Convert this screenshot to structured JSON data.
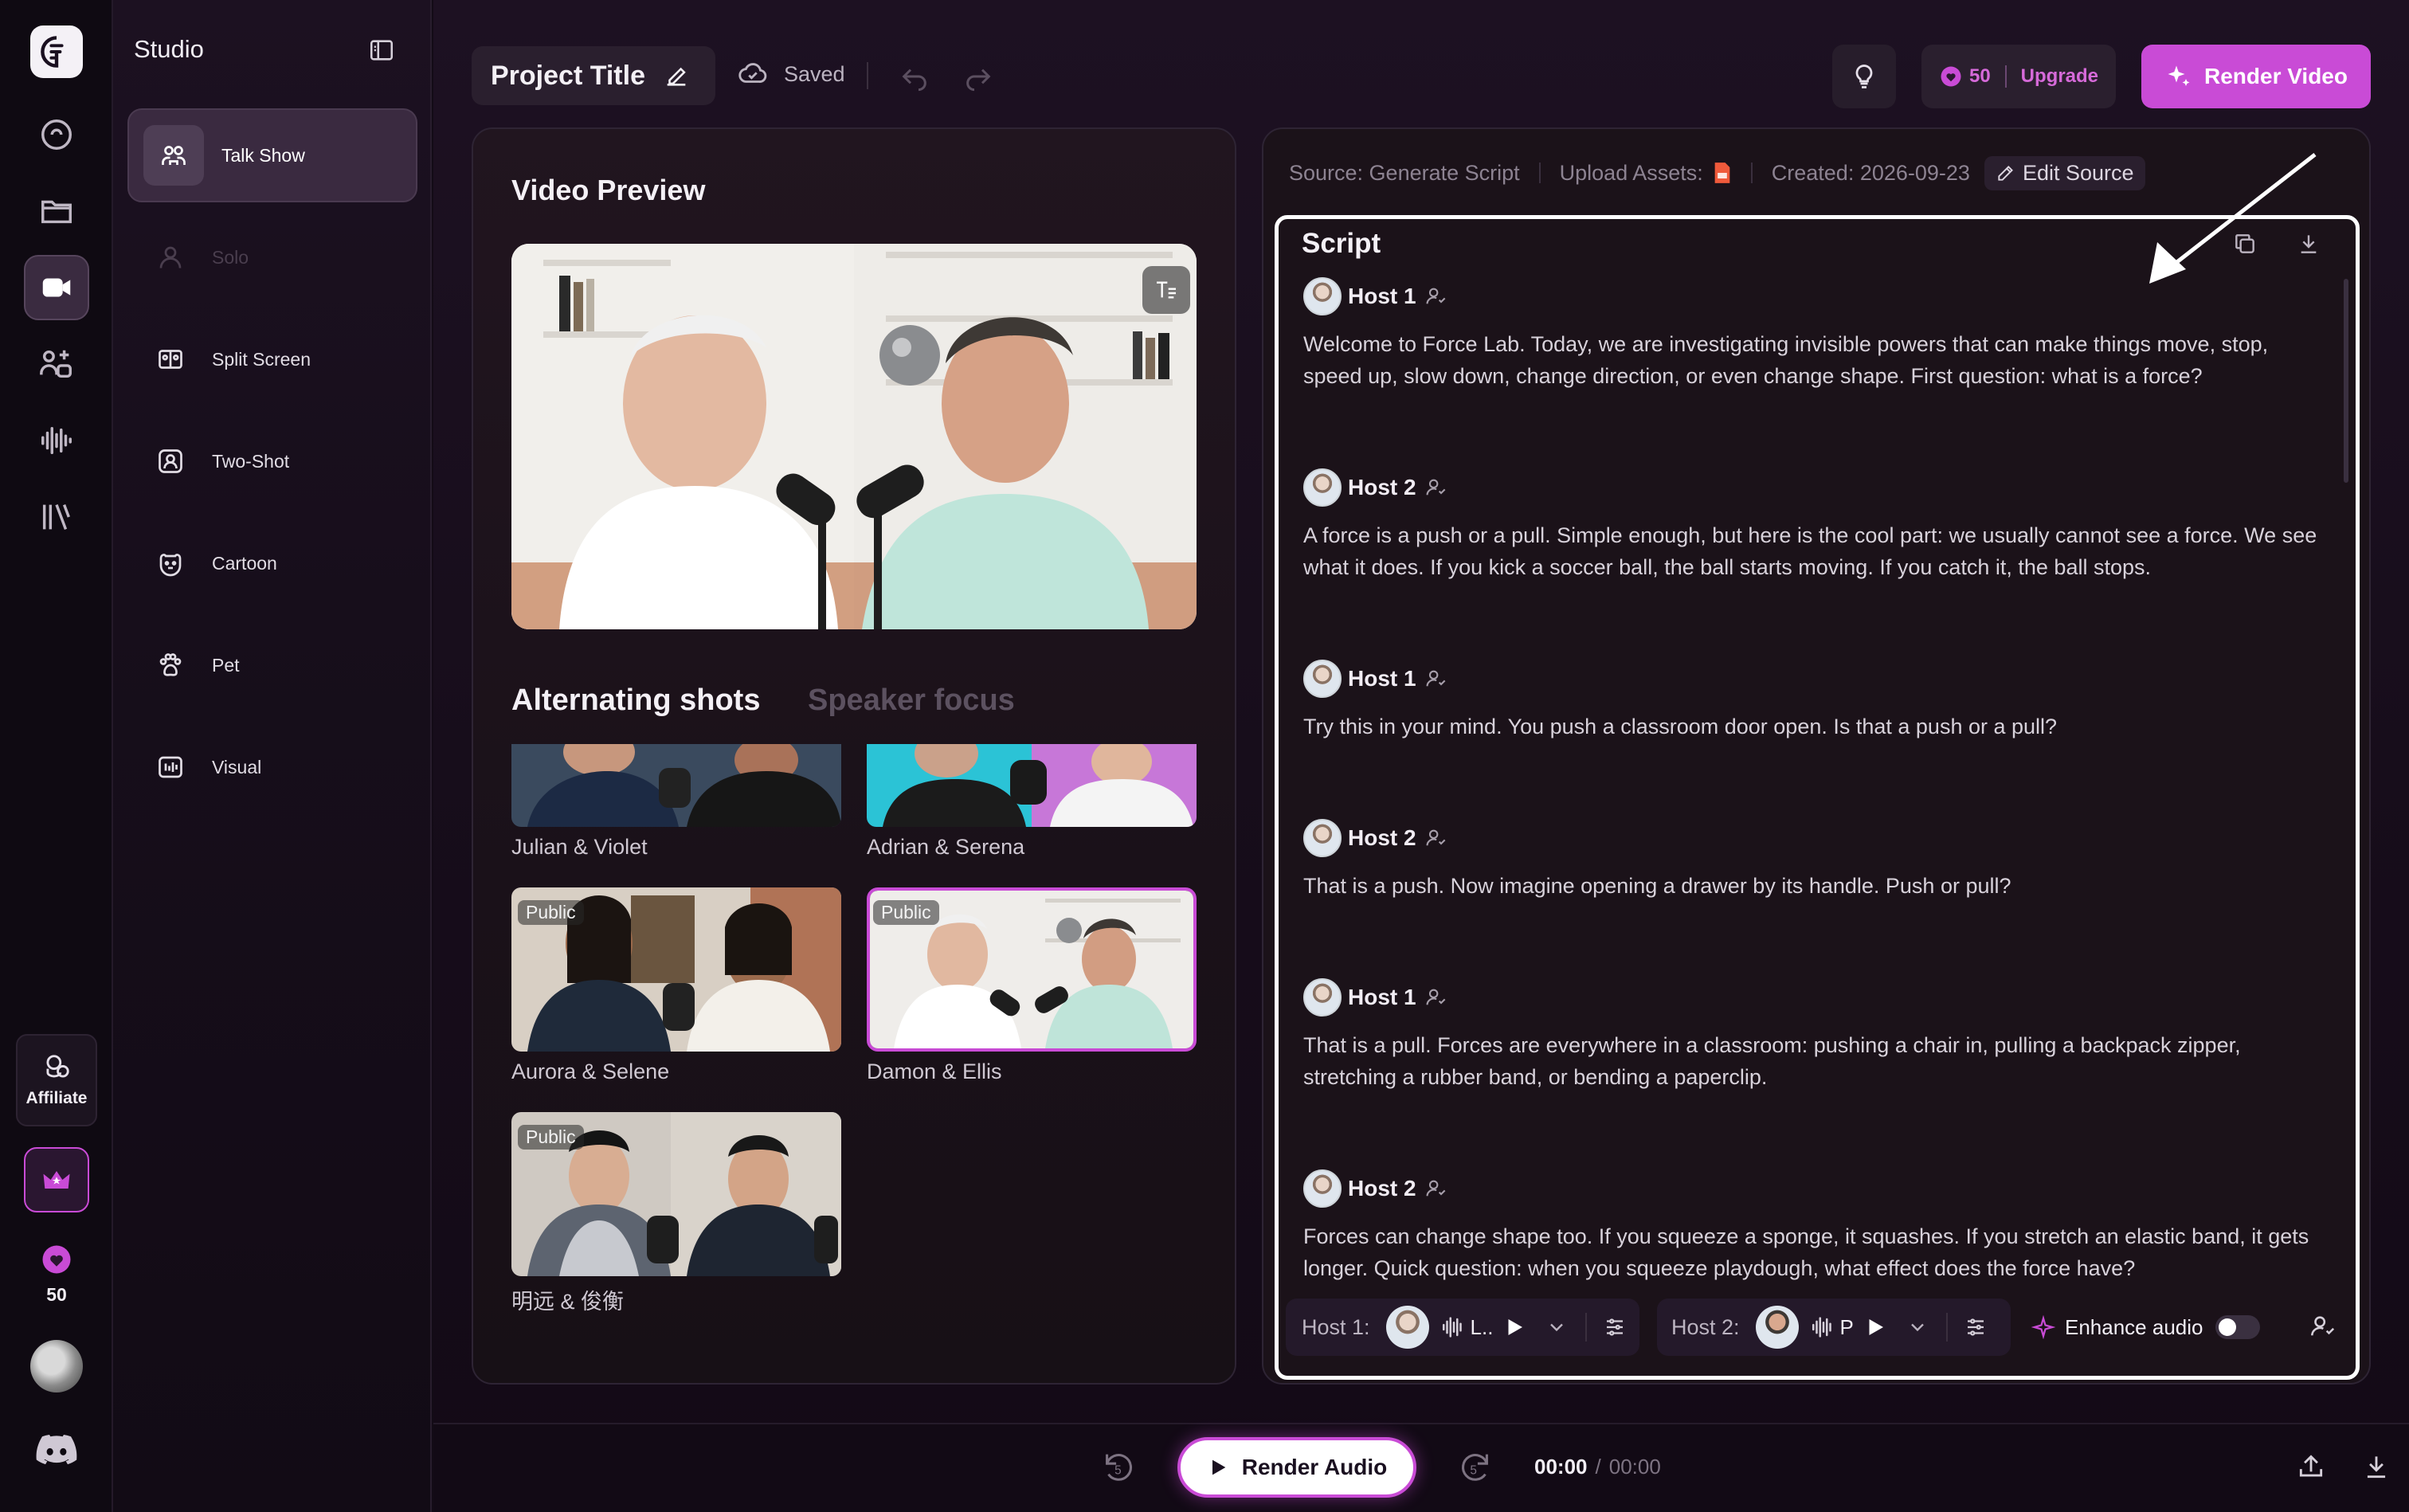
{
  "rail": {
    "affiliate_label": "Affiliate",
    "credits": "50"
  },
  "sidebar": {
    "title": "Studio",
    "items": [
      {
        "label": "Talk Show",
        "icon": "talk-show-icon"
      },
      {
        "label": "Solo",
        "icon": "solo-icon"
      },
      {
        "label": "Split Screen",
        "icon": "split-screen-icon"
      },
      {
        "label": "Two-Shot",
        "icon": "two-shot-icon"
      },
      {
        "label": "Cartoon",
        "icon": "cartoon-icon"
      },
      {
        "label": "Pet",
        "icon": "pet-icon"
      },
      {
        "label": "Visual",
        "icon": "visual-icon"
      }
    ]
  },
  "header": {
    "project_title": "Project Title",
    "saved": "Saved",
    "credits": "50",
    "upgrade": "Upgrade",
    "render_video": "Render Video"
  },
  "preview": {
    "title": "Video Preview",
    "tabs": [
      "Alternating shots",
      "Speaker focus"
    ],
    "pairs": [
      {
        "name": "Julian & Violet",
        "public": false
      },
      {
        "name": "Adrian & Serena",
        "public": false
      },
      {
        "name": "Aurora & Selene",
        "public": true
      },
      {
        "name": "Damon & Ellis",
        "public": true
      },
      {
        "name": "明远 & 俊衡",
        "public": true
      }
    ],
    "public_tag": "Public"
  },
  "source_bar": {
    "source": "Source: Generate Script",
    "upload": "Upload Assets:",
    "created": "Created: 2026-09-23",
    "edit_source": "Edit Source"
  },
  "script": {
    "title": "Script",
    "lines": [
      {
        "host": "Host 1",
        "text": "Welcome to Force Lab. Today, we are investigating invisible powers that can make things move, stop, speed up, slow down, change direction, or even change shape. First question: what is a force?"
      },
      {
        "host": "Host 2",
        "text": "A force is a push or a pull. Simple enough, but here is the cool part: we usually cannot see a force. We see what it does. If you kick a soccer ball, the ball starts moving. If you catch it, the ball stops."
      },
      {
        "host": "Host 1",
        "text": "Try this in your mind. You push a classroom door open. Is that a push or a pull?"
      },
      {
        "host": "Host 2",
        "text": "That is a push. Now imagine opening a drawer by its handle. Push or pull?"
      },
      {
        "host": "Host 1",
        "text": "That is a pull. Forces are everywhere in a classroom: pushing a chair in, pulling a backpack zipper, stretching a rubber band, or bending a paperclip."
      },
      {
        "host": "Host 2",
        "text": "Forces can change shape too. If you squeeze a sponge, it squashes. If you stretch an elastic band, it gets longer. Quick question: when you squeeze playdough, what effect does the force have?"
      }
    ]
  },
  "voice_bar": {
    "host1_label": "Host 1:",
    "host1_voice": "L..",
    "host2_label": "Host 2:",
    "host2_voice": "P",
    "enhance_audio": "Enhance audio",
    "enhance_on": false
  },
  "player": {
    "render_audio": "Render Audio",
    "time_current": "00:00",
    "time_sep": "/",
    "time_total": "00:00",
    "skip_back": "5",
    "skip_fwd": "5"
  },
  "colors": {
    "accent": "#c94bd6",
    "accent_text": "#d66ad9",
    "highlight_border": "#ffffff",
    "bg": "#130b16"
  }
}
